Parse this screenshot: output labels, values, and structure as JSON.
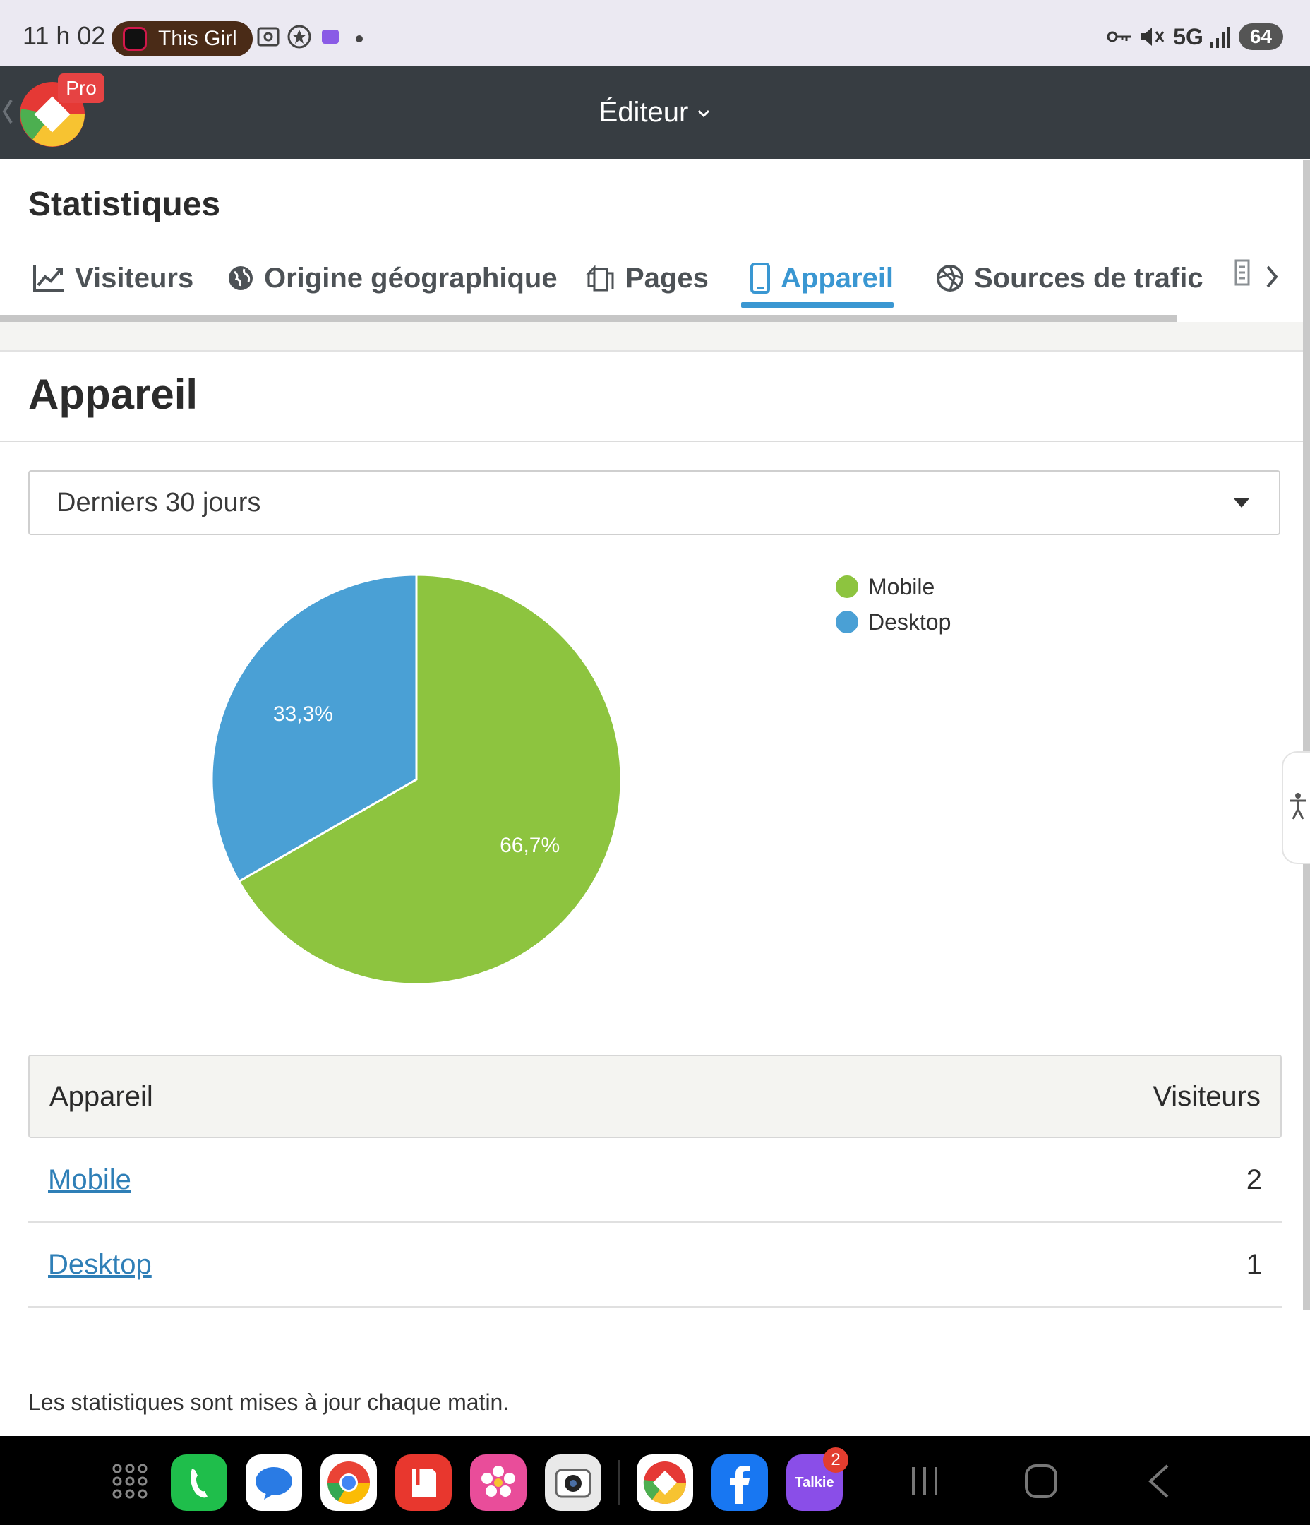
{
  "status_bar": {
    "time": "11 h 02",
    "media_title": "This Girl",
    "network": "5G",
    "battery": "64"
  },
  "header": {
    "badge": "Pro",
    "title": "Éditeur"
  },
  "page": {
    "title": "Statistiques",
    "section_title": "Appareil",
    "footer_note": "Les statistiques sont mises à jour chaque matin."
  },
  "tabs": [
    {
      "label": "Visiteurs",
      "icon": "line-chart-icon",
      "active": false
    },
    {
      "label": "Origine géographique",
      "icon": "globe-icon",
      "active": false
    },
    {
      "label": "Pages",
      "icon": "pages-icon",
      "active": false
    },
    {
      "label": "Appareil",
      "icon": "mobile-icon",
      "active": true
    },
    {
      "label": "Sources de trafic",
      "icon": "traffic-icon",
      "active": false
    }
  ],
  "period_select": {
    "value": "Derniers 30 jours"
  },
  "chart_data": {
    "type": "pie",
    "categories": [
      "Mobile",
      "Desktop"
    ],
    "values": [
      66.7,
      33.3
    ],
    "labels": [
      "66,7%",
      "33,3%"
    ],
    "colors": [
      "#8dc43f",
      "#4aa0d5"
    ],
    "legend": "top-right"
  },
  "table": {
    "headers": [
      "Appareil",
      "Visiteurs"
    ],
    "rows": [
      {
        "device": "Mobile",
        "visitors": "2"
      },
      {
        "device": "Desktop",
        "visitors": "1"
      }
    ]
  },
  "dock": {
    "talkie_label": "Talkie",
    "talkie_badge": "2"
  },
  "colors": {
    "accent": "#3a97d2",
    "header_bg": "#373d42",
    "mobile": "#8dc43f",
    "desktop": "#4aa0d5"
  }
}
